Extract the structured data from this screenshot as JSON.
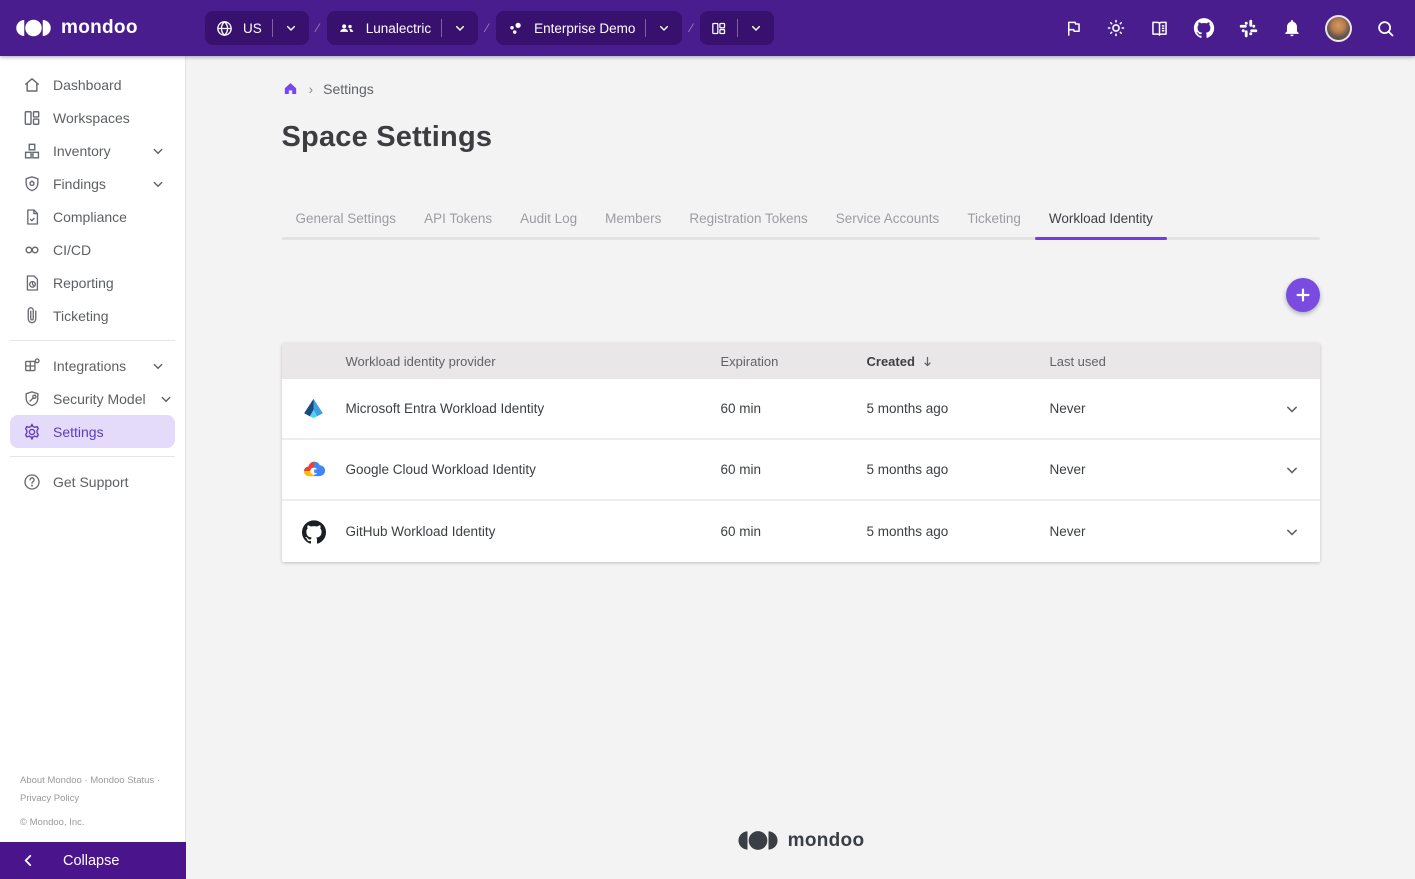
{
  "topbar": {
    "brand": "mondoo",
    "region_selector": {
      "label": "US"
    },
    "org_selector": {
      "label": "Lunalectric"
    },
    "space_selector": {
      "label": "Enterprise Demo"
    },
    "action_icons": [
      "flag",
      "theme-light",
      "documentation",
      "github",
      "slack",
      "notifications",
      "account",
      "search"
    ]
  },
  "sidebar": {
    "items": [
      {
        "label": "Dashboard"
      },
      {
        "label": "Workspaces"
      },
      {
        "label": "Inventory",
        "expandable": true
      },
      {
        "label": "Findings",
        "expandable": true
      },
      {
        "label": "Compliance"
      },
      {
        "label": "CI/CD"
      },
      {
        "label": "Reporting"
      },
      {
        "label": "Ticketing"
      },
      {
        "label": "Integrations",
        "expandable": true
      },
      {
        "label": "Security Model",
        "expandable": true
      },
      {
        "label": "Settings",
        "active": true
      },
      {
        "label": "Get Support"
      }
    ],
    "footer": {
      "links": [
        "About Mondoo",
        "Mondoo Status",
        "Privacy Policy"
      ],
      "separator": "·",
      "copyright": "© Mondoo, Inc."
    },
    "collapse_label": "Collapse"
  },
  "breadcrumb": {
    "separator": "›",
    "current": "Settings"
  },
  "page": {
    "title": "Space Settings"
  },
  "tabs": {
    "items": [
      {
        "label": "General Settings"
      },
      {
        "label": "API Tokens"
      },
      {
        "label": "Audit Log"
      },
      {
        "label": "Members"
      },
      {
        "label": "Registration Tokens"
      },
      {
        "label": "Service Accounts"
      },
      {
        "label": "Ticketing"
      },
      {
        "label": "Workload Identity",
        "active": true
      }
    ]
  },
  "table": {
    "columns": {
      "provider": "Workload identity provider",
      "expiration": "Expiration",
      "created": "Created",
      "last_used": "Last used"
    },
    "sort": {
      "column": "Created",
      "direction": "desc"
    },
    "rows": [
      {
        "icon": "microsoft-entra",
        "provider": "Microsoft Entra Workload Identity",
        "expiration": "60 min",
        "created": "5 months ago",
        "last_used": "Never"
      },
      {
        "icon": "google-cloud",
        "provider": "Google Cloud Workload Identity",
        "expiration": "60 min",
        "created": "5 months ago",
        "last_used": "Never"
      },
      {
        "icon": "github",
        "provider": "GitHub Workload Identity",
        "expiration": "60 min",
        "created": "5 months ago",
        "last_used": "Never"
      }
    ]
  },
  "footer": {
    "brand": "mondoo"
  },
  "colors": {
    "topbar_bg": "#4a1d8e",
    "pill_bg": "#38116e",
    "collapse_bg": "#4a148c",
    "accent_purple": "#6e40d4",
    "add_button": "#7a4be0",
    "active_nav_bg": "#e4dafa",
    "active_nav_text": "#5e3bbd"
  }
}
